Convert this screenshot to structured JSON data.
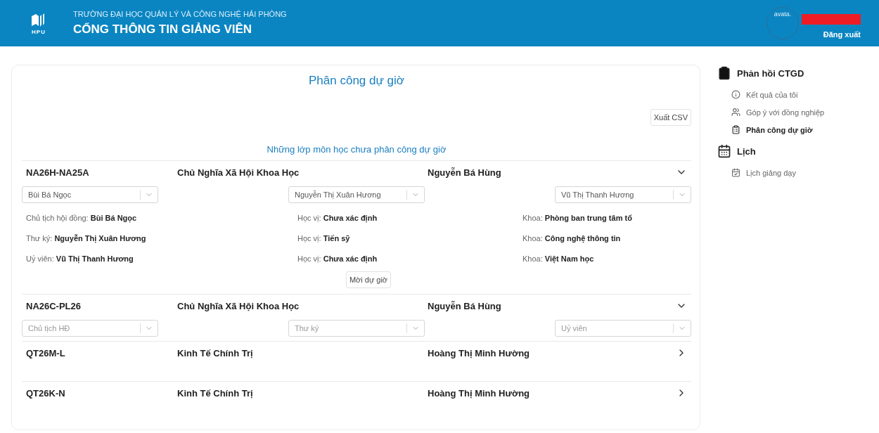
{
  "header": {
    "school": "TRƯỜNG ĐẠI HỌC QUẢN LÝ VÀ CÔNG NGHỆ HẢI PHÒNG",
    "portal": "CỔNG THÔNG TIN GIẢNG VIÊN",
    "logo_text": "HPU",
    "avatar_alt": "avata.",
    "logout": "Đăng xuất"
  },
  "main": {
    "title": "Phân công dự giờ",
    "export_button": "Xuất CSV",
    "subtitle": "Những lớp môn học chưa phân công dự giờ",
    "groups": [
      {
        "code": "NA26H-NA25A",
        "subject": "Chủ Nghĩa Xã Hội Khoa Học",
        "teacher": "Nguyễn Bá Hùng",
        "expanded": true,
        "selects": [
          {
            "value": "Bùi Bá Ngọc"
          },
          {
            "value": "Nguyễn Thị Xuân Hương"
          },
          {
            "value": "Vũ Thị Thanh Hương"
          }
        ],
        "details": [
          {
            "role_label": "Chủ tịch hội đồng:",
            "name": "Bùi Bá Ngọc",
            "degree_label": "Học vị:",
            "degree": "Chưa xác định",
            "dept_label": "Khoa:",
            "dept": "Phòng ban trung tâm tổ"
          },
          {
            "role_label": "Thư ký:",
            "name": "Nguyễn Thị Xuân Hương",
            "degree_label": "Học vị:",
            "degree": "Tiến sỹ",
            "dept_label": "Khoa:",
            "dept": "Công nghệ thông tin"
          },
          {
            "role_label": "Uỷ viên:",
            "name": "Vũ Thị Thanh Hương",
            "degree_label": "Học vị:",
            "degree": "Chưa xác định",
            "dept_label": "Khoa:",
            "dept": "Việt Nam học"
          }
        ],
        "invite_button": "Mời dự giờ"
      },
      {
        "code": "NA26C-PL26",
        "subject": "Chủ Nghĩa Xã Hội Khoa Học",
        "teacher": "Nguyễn Bá Hùng",
        "expanded": true,
        "selects": [
          {
            "placeholder": "Chủ tịch HĐ"
          },
          {
            "placeholder": "Thư ký"
          },
          {
            "placeholder": "Uỷ viên"
          }
        ]
      },
      {
        "code": "QT26M-L",
        "subject": "Kinh Tế Chính Trị",
        "teacher": "Hoàng Thị Minh Hường",
        "expanded": false
      },
      {
        "code": "QT26K-N",
        "subject": "Kinh Tế Chính Trị",
        "teacher": "Hoàng Thị Minh Hường",
        "expanded": false
      }
    ]
  },
  "sidebar": {
    "sections": [
      {
        "kind": "feedback",
        "title": "Phản hồi CTGD",
        "items": [
          {
            "kind": "info",
            "label": "Kết quả của tôi",
            "selected": false
          },
          {
            "kind": "people",
            "label": "Góp ý với đồng nghiệp",
            "selected": false
          },
          {
            "kind": "clipboard",
            "label": "Phân công dự giờ",
            "selected": true
          }
        ]
      },
      {
        "kind": "calendar",
        "title": "Lịch",
        "items": [
          {
            "kind": "calendar",
            "label": "Lịch giảng dạy",
            "selected": false
          }
        ]
      }
    ]
  }
}
